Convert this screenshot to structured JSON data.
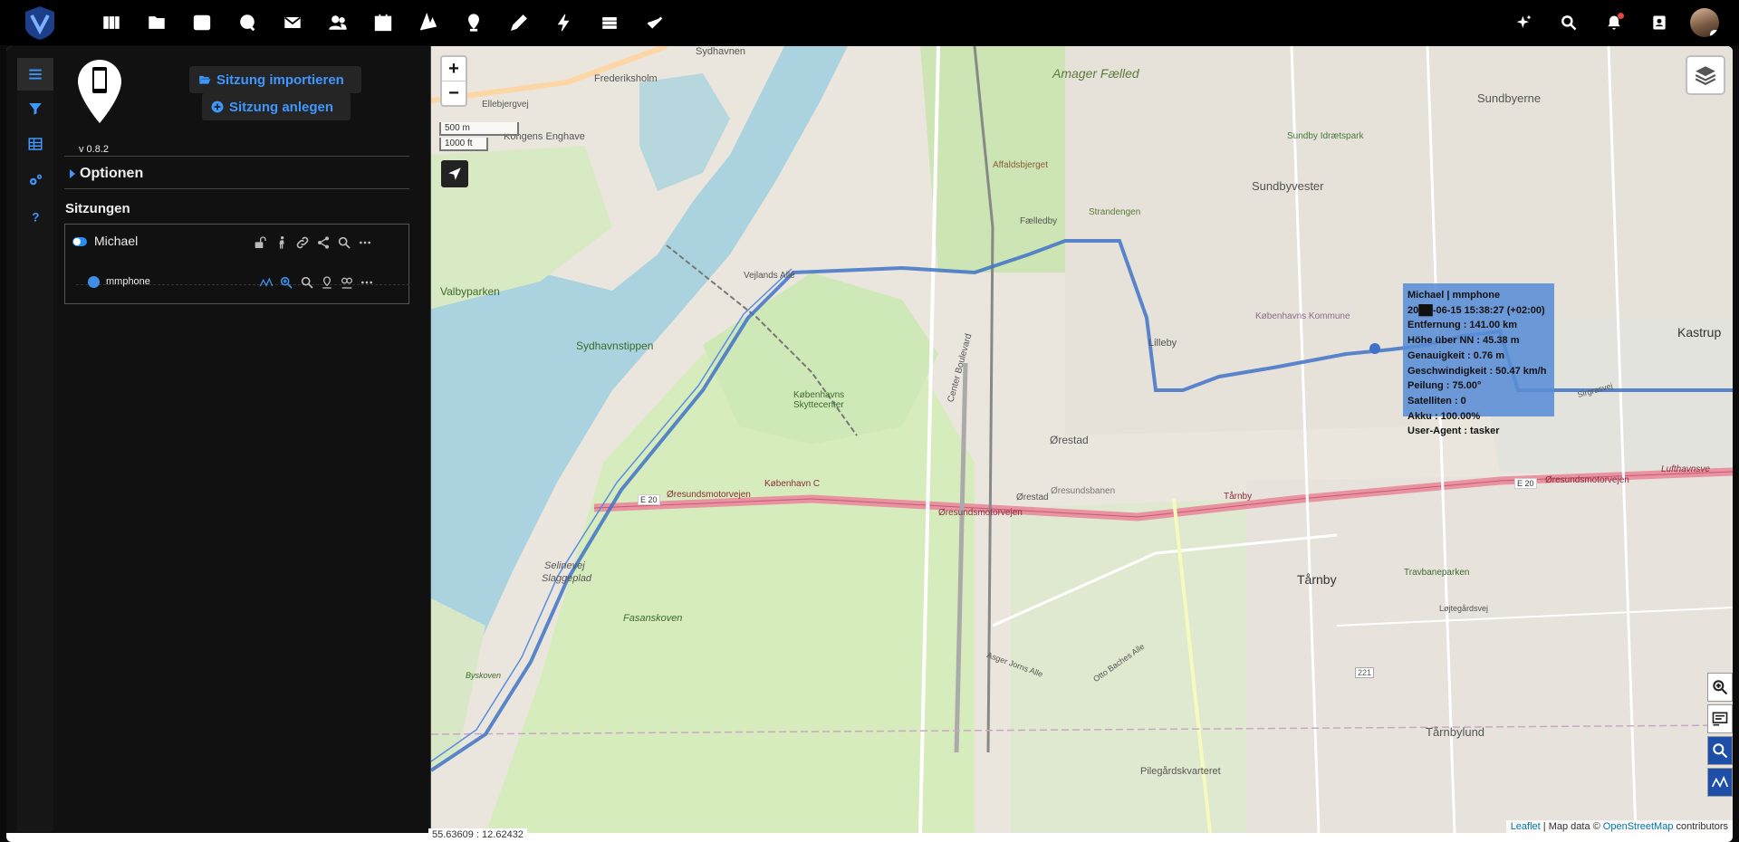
{
  "app": {
    "accent_color": "#3e97ff",
    "nav_icons": [
      "dashboard-icon",
      "files-icon",
      "photos-icon",
      "talk-icon",
      "mail-icon",
      "contacts-icon",
      "calendar-icon",
      "notes-icon",
      "maps-icon",
      "text-icon",
      "activity-icon",
      "deck-icon",
      "tasks-icon"
    ],
    "right_icons": [
      "assistant-icon",
      "search-icon",
      "notifications-icon",
      "contacts-menu-icon"
    ]
  },
  "sidebar": {
    "version": "v 0.8.2",
    "import_button": "Sitzung importieren",
    "create_button": "Sitzung anlegen",
    "options_label": "Optionen",
    "sessions_label": "Sitzungen",
    "sessions": [
      {
        "name": "Michael",
        "devices": [
          {
            "name": "mmphone",
            "color": "#3e8fe8"
          }
        ]
      }
    ]
  },
  "map": {
    "zoom_in": "+",
    "zoom_out": "−",
    "scale_metric": "500 m",
    "scale_imperial": "1000 ft",
    "coords": "55.63609 : 12.62432",
    "attribution": {
      "leaflet": "Leaflet",
      "sep": "| Map data ©",
      "osm": "OpenStreetMap",
      "suffix": "contributors"
    },
    "track_color": "#3f73c8",
    "popup": {
      "title": "Michael | mmphone",
      "date": "20██-06-15 15:38:27 (+02:00)",
      "distance": "Entfernung : 141.00 km",
      "altitude": "Höhe über NN : 45.38 m",
      "accuracy": "Genauigkeit : 0.76 m",
      "speed": "Geschwindigkeit : 50.47 km/h",
      "bearing": "Peilung : 75.00°",
      "satellites": "Satelliten : 0",
      "battery": "Akku : 100.00%",
      "useragent": "User-Agent : tasker"
    },
    "labels": {
      "sydhavnen": "Sydhavnen",
      "frederiksholm": "Frederiksholm",
      "ellebjergvej": "Ellebjergvej",
      "kongens_enghave": "Kongens Enghave",
      "amager_faelled": "Amager Fælled",
      "sundbyerne": "Sundbyerne",
      "sundbyvester": "Sundbyvester",
      "sundby_idraetspark": "Sundby Idrætspark",
      "affaldsbjerget": "Affaldsbjerget",
      "faelledby": "Fælledby",
      "strandengen": "Strandengen",
      "vejlands_alle": "Vejlands Allé",
      "kobenhavns_kommune": "Københavns Kommune",
      "valbyparken": "Valbyparken",
      "sydhavnstippen": "Sydhavnstippen",
      "kobenhavns_skyttecenter": "Københavns Skyttecenter",
      "lilleby": "Lilleby",
      "orestad": "Ørestad",
      "center_boulevard": "Center Boulevard",
      "oresundsmotorvejen": "Øresundsmotorvejen",
      "kobenhavn_c": "København C",
      "e20": "E 20",
      "selinevej": "Selinevej",
      "slaggeplad": "Slaggeplad",
      "fasanskoven": "Fasanskoven",
      "byskoven": "Byskoven",
      "tarnby": "Tårnby",
      "travbaneparken": "Travbaneparken",
      "tarnbylund": "Tårnbylund",
      "pilegardskvarteret": "Pilegårdskvarteret",
      "kastrup": "Kastrup",
      "loejtegardsvej": "Løjtegårdsvej",
      "asger_jorns_alle": "Asger Jorns Alle",
      "otto_baches_alle": "Otto Baches Alle",
      "orestad_station": "Ørestad",
      "oresundsbanen": "Øresundsbanen",
      "sirgrasvej": "Sirgrasvej",
      "r221": "221",
      "tarnby_station": "Tårnby",
      "lufthavnsvej": "Lufthavnsve"
    }
  }
}
